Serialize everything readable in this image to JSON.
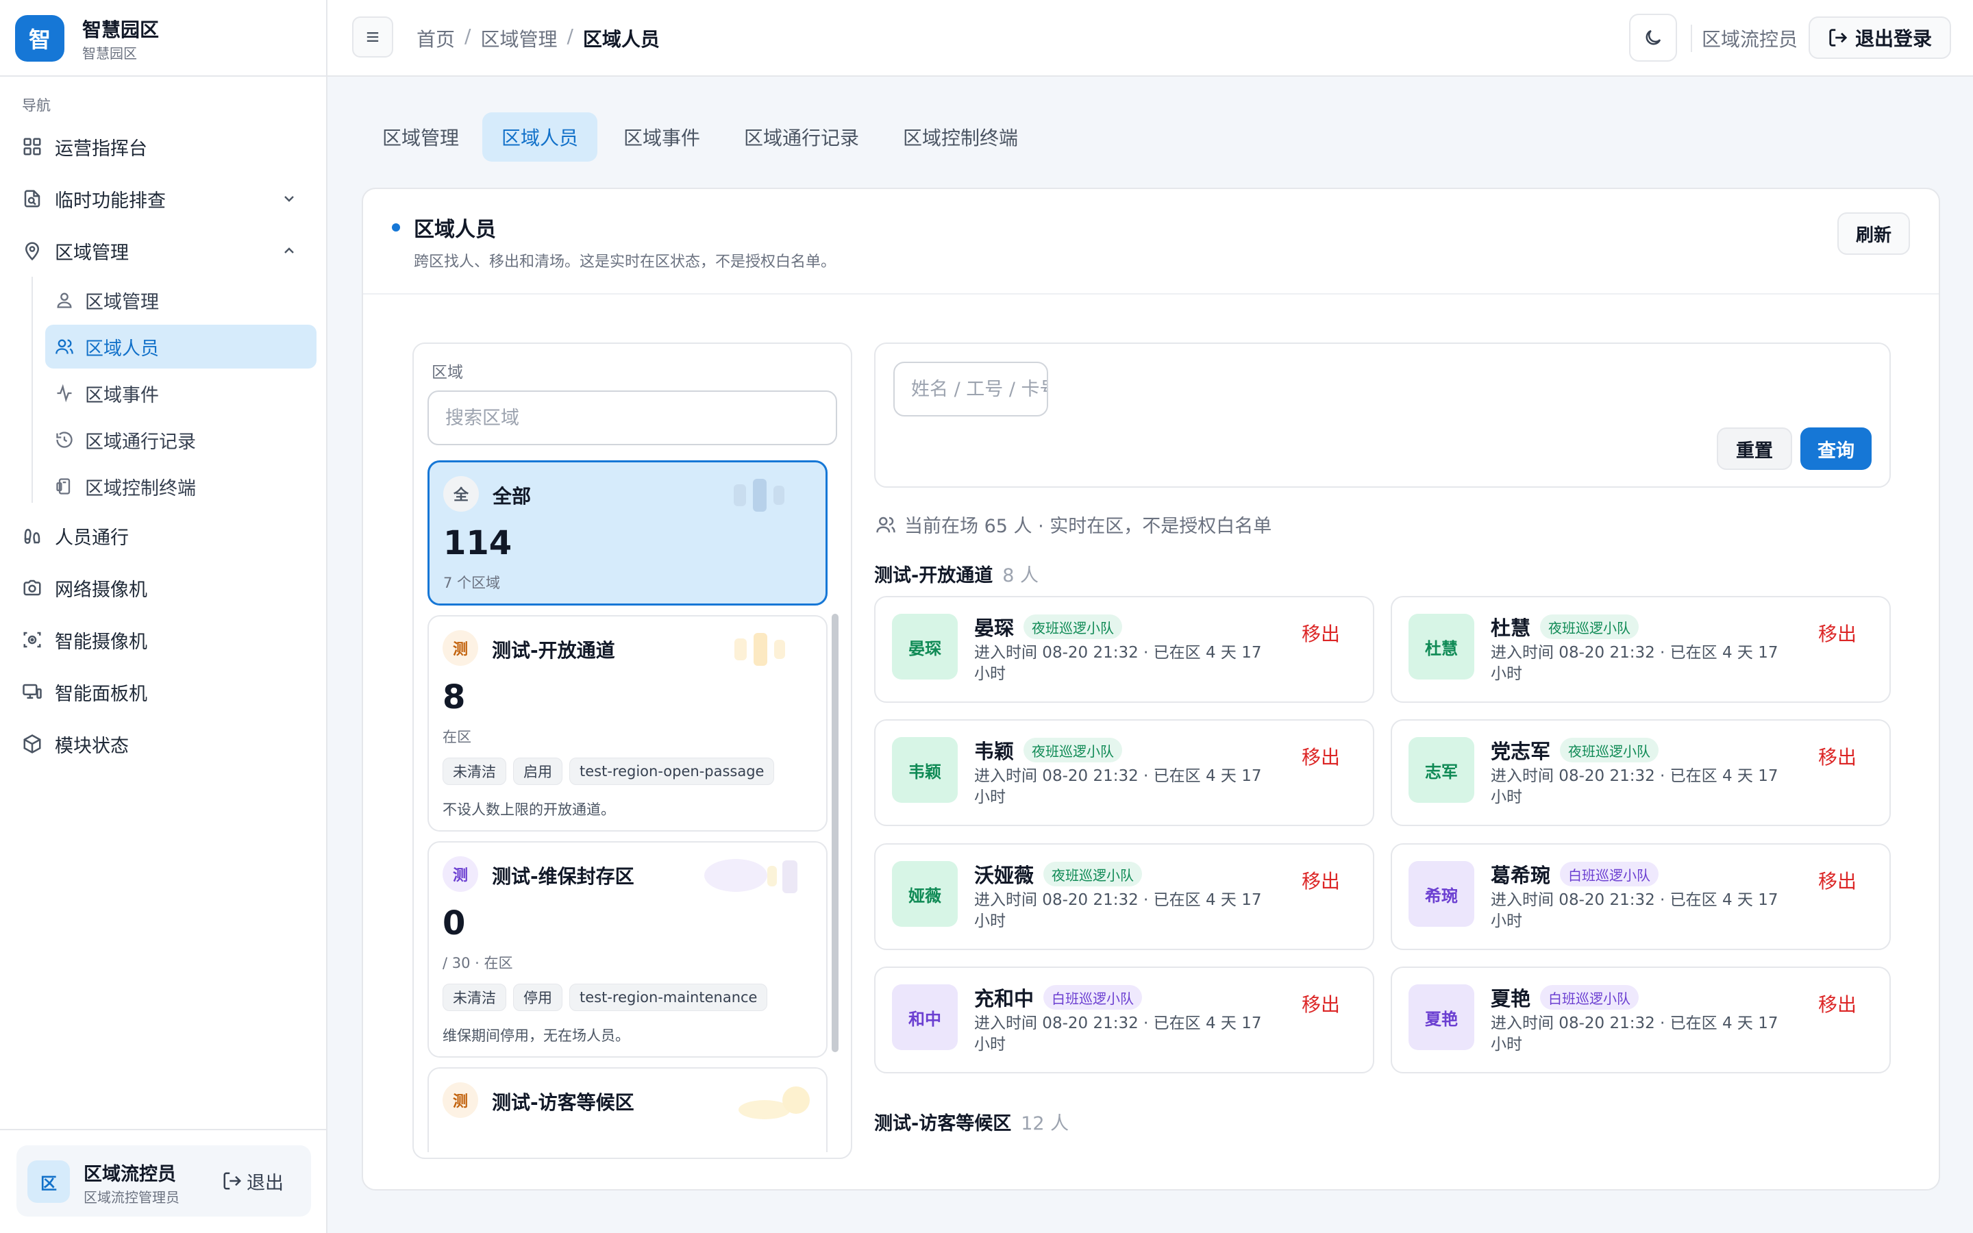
{
  "brand": {
    "logo": "智",
    "name": "智慧园区",
    "sub": "智慧园区"
  },
  "nav": {
    "section": "导航",
    "items": [
      {
        "label": "运营指挥台",
        "icon": "grid-icon"
      },
      {
        "label": "临时功能排查",
        "icon": "file-search-icon"
      },
      {
        "label": "区域管理",
        "icon": "map-pin-icon"
      },
      {
        "label": "人员通行",
        "icon": "footprints-icon"
      },
      {
        "label": "网络摄像机",
        "icon": "camera-icon"
      },
      {
        "label": "智能摄像机",
        "icon": "scan-camera-icon"
      },
      {
        "label": "智能面板机",
        "icon": "monitor-icon"
      },
      {
        "label": "模块状态",
        "icon": "package-icon"
      }
    ],
    "sub_items": [
      {
        "label": "区域管理",
        "icon": "user-pin-icon"
      },
      {
        "label": "区域人员",
        "icon": "users-icon"
      },
      {
        "label": "区域事件",
        "icon": "activity-icon"
      },
      {
        "label": "区域通行记录",
        "icon": "history-icon"
      },
      {
        "label": "区域控制终端",
        "icon": "device-icon"
      }
    ]
  },
  "user": {
    "avatar": "区",
    "name": "区域流控员",
    "role": "区域流控管理员",
    "logout": "退出"
  },
  "header": {
    "breadcrumb": [
      "首页",
      "区域管理",
      "区域人员"
    ],
    "separator": "/",
    "role": "区域流控员",
    "logout": "退出登录"
  },
  "tabs": [
    "区域管理",
    "区域人员",
    "区域事件",
    "区域通行记录",
    "区域控制终端"
  ],
  "card": {
    "title": "区域人员",
    "desc": "跨区找人、移出和清场。这是实时在区状态，不是授权白名单。",
    "refresh": "刷新"
  },
  "region_panel": {
    "label": "区域",
    "search_placeholder": "搜索区域",
    "regions": [
      {
        "badge": "全",
        "name": "全部",
        "count": "114",
        "sub": "7 个区域",
        "tags": [],
        "desc": ""
      },
      {
        "badge": "测",
        "name": "测试-开放通道",
        "count": "8",
        "sub": "在区",
        "tags": [
          "未清洁",
          "启用",
          "test-region-open-passage"
        ],
        "desc": "不设人数上限的开放通道。"
      },
      {
        "badge": "测",
        "name": "测试-维保封存区",
        "count": "0",
        "sub": "/ 30 · 在区",
        "tags": [
          "未清洁",
          "停用",
          "test-region-maintenance"
        ],
        "desc": "维保期间停用，无在场人员。"
      },
      {
        "badge": "测",
        "name": "测试-访客等候区",
        "count": "",
        "sub": "",
        "tags": [],
        "desc": ""
      }
    ]
  },
  "filter": {
    "placeholder": "姓名 / 工号 / 卡号",
    "reset": "重置",
    "query": "查询"
  },
  "present_text": "当前在场 65 人 · 实时在区，不是授权白名单",
  "groups": [
    {
      "name": "测试-开放通道",
      "count": "8 人",
      "people": [
        {
          "avatar": "晏琛",
          "name": "晏琛",
          "team": "夜班巡逻小队",
          "color": "green",
          "info": "进入时间 08-20 21:32 · 已在区 4 天 17 小时",
          "action": "移出"
        },
        {
          "avatar": "杜慧",
          "name": "杜慧",
          "team": "夜班巡逻小队",
          "color": "green",
          "info": "进入时间 08-20 21:32 · 已在区 4 天 17 小时",
          "action": "移出"
        },
        {
          "avatar": "韦颖",
          "name": "韦颖",
          "team": "夜班巡逻小队",
          "color": "green",
          "info": "进入时间 08-20 21:32 · 已在区 4 天 17 小时",
          "action": "移出"
        },
        {
          "avatar": "志军",
          "name": "党志军",
          "team": "夜班巡逻小队",
          "color": "green",
          "info": "进入时间 08-20 21:32 · 已在区 4 天 17 小时",
          "action": "移出"
        },
        {
          "avatar": "娅薇",
          "name": "沃娅薇",
          "team": "夜班巡逻小队",
          "color": "green",
          "info": "进入时间 08-20 21:32 · 已在区 4 天 17 小时",
          "action": "移出"
        },
        {
          "avatar": "希琬",
          "name": "葛希琬",
          "team": "白班巡逻小队",
          "color": "purple",
          "info": "进入时间 08-20 21:32 · 已在区 4 天 17 小时",
          "action": "移出"
        },
        {
          "avatar": "和中",
          "name": "充和中",
          "team": "白班巡逻小队",
          "color": "purple",
          "info": "进入时间 08-20 21:32 · 已在区 4 天 17 小时",
          "action": "移出"
        },
        {
          "avatar": "夏艳",
          "name": "夏艳",
          "team": "白班巡逻小队",
          "color": "purple",
          "info": "进入时间 08-20 21:32 · 已在区 4 天 17 小时",
          "action": "移出"
        }
      ]
    },
    {
      "name": "测试-访客等候区",
      "count": "12 人",
      "people": []
    }
  ],
  "colors": {
    "primary": "#1677d6",
    "active_bg": "#d6ebfb",
    "danger": "#dc2626",
    "green": "#0f8a55",
    "purple": "#6b3fd1"
  }
}
